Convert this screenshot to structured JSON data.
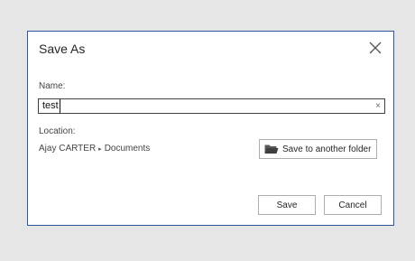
{
  "dialog": {
    "title": "Save As",
    "close_icon": "close-icon",
    "border_color": "#2b579a"
  },
  "name": {
    "label": "Name:",
    "value": "test",
    "clear_glyph": "×"
  },
  "location": {
    "label": "Location:",
    "path": [
      "Ajay CARTER",
      "Documents"
    ],
    "separator": "▸"
  },
  "buttons": {
    "another_folder": "Save to another folder",
    "another_folder_icon": "folder-open-icon",
    "save": "Save",
    "cancel": "Cancel"
  }
}
